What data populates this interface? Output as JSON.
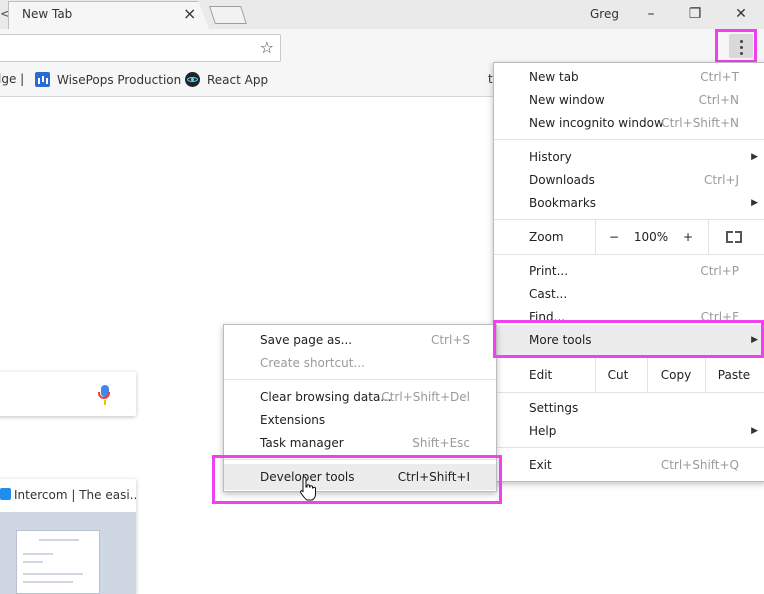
{
  "browser": {
    "tab_fragment": "<",
    "tab_title": "New Tab",
    "tab_close": "×",
    "user_name": "Greg",
    "window_controls": {
      "minimize": "–",
      "restore": "❐",
      "close": "✕"
    }
  },
  "toolbar": {
    "star_icon": "☆"
  },
  "bookmarks": [
    {
      "label": "lge |",
      "icon": "edge-fragment"
    },
    {
      "label": "WisePops Production",
      "icon": "wisepops-icon"
    },
    {
      "label": "React App",
      "icon": "react-icon"
    },
    {
      "label": "t",
      "icon": ""
    }
  ],
  "page": {
    "tile_title": "Intercom | The easi..."
  },
  "main_menu": {
    "new_tab": {
      "label": "New tab",
      "shortcut": "Ctrl+T"
    },
    "new_window": {
      "label": "New window",
      "shortcut": "Ctrl+N"
    },
    "new_incognito": {
      "label": "New incognito window",
      "shortcut": "Ctrl+Shift+N"
    },
    "history": {
      "label": "History"
    },
    "downloads": {
      "label": "Downloads",
      "shortcut": "Ctrl+J"
    },
    "bookmarks": {
      "label": "Bookmarks"
    },
    "zoom": {
      "label": "Zoom",
      "minus": "−",
      "value": "100%",
      "plus": "+"
    },
    "print": {
      "label": "Print...",
      "shortcut": "Ctrl+P"
    },
    "cast": {
      "label": "Cast..."
    },
    "find": {
      "label": "Find...",
      "shortcut": "Ctrl+F"
    },
    "more_tools": {
      "label": "More tools"
    },
    "edit": {
      "label": "Edit",
      "cut": "Cut",
      "copy": "Copy",
      "paste": "Paste"
    },
    "settings": {
      "label": "Settings"
    },
    "help": {
      "label": "Help"
    },
    "exit": {
      "label": "Exit",
      "shortcut": "Ctrl+Shift+Q"
    }
  },
  "sub_menu": {
    "save_page": {
      "label": "Save page as...",
      "shortcut": "Ctrl+S"
    },
    "create_shortcut": {
      "label": "Create shortcut..."
    },
    "clear_browsing": {
      "label": "Clear browsing data...",
      "shortcut": "Ctrl+Shift+Del"
    },
    "extensions": {
      "label": "Extensions"
    },
    "task_manager": {
      "label": "Task manager",
      "shortcut": "Shift+Esc"
    },
    "developer_tools": {
      "label": "Developer tools",
      "shortcut": "Ctrl+Shift+I"
    }
  },
  "colors": {
    "highlight": "#f041f0",
    "menu_hover": "#ececec"
  }
}
